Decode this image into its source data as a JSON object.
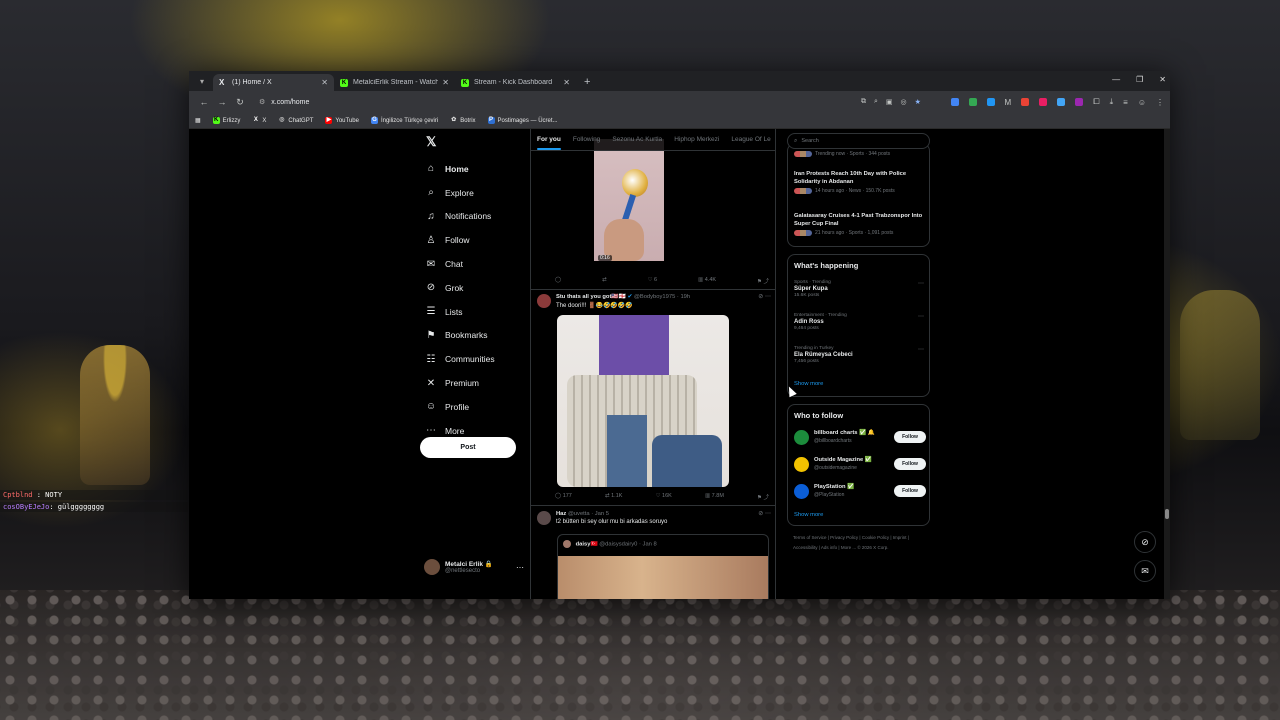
{
  "overlay_chat": [
    {
      "user": "Cptblnd",
      "msg": "NOTY"
    },
    {
      "user": "cosOByEJeJo",
      "msg": ": gülgggggggg"
    }
  ],
  "browser": {
    "tabs": [
      {
        "title": "(1) Home / X",
        "active": true,
        "favicon": "x-logo-icon"
      },
      {
        "title": "MetalciErlik Stream - Watch Liv",
        "active": false,
        "favicon": "kick-icon"
      },
      {
        "title": "Stream - Kick Dashboard",
        "active": false,
        "favicon": "kick-icon"
      }
    ],
    "url": "x.com/home",
    "bookmarks": [
      "Erlizzy",
      "X",
      "ChatGPT",
      "YouTube",
      "İngilizce Türkçe çeviri",
      "Botrix",
      "Postimages — Ücret..."
    ]
  },
  "nav": {
    "items": [
      {
        "label": "Home",
        "icon": "home-icon"
      },
      {
        "label": "Explore",
        "icon": "search-icon"
      },
      {
        "label": "Notifications",
        "icon": "bell-icon"
      },
      {
        "label": "Follow",
        "icon": "follow-icon"
      },
      {
        "label": "Chat",
        "icon": "chat-icon"
      },
      {
        "label": "Grok",
        "icon": "grok-icon"
      },
      {
        "label": "Lists",
        "icon": "lists-icon"
      },
      {
        "label": "Bookmarks",
        "icon": "bookmark-icon"
      },
      {
        "label": "Communities",
        "icon": "communities-icon"
      },
      {
        "label": "Premium",
        "icon": "x-logo-icon"
      },
      {
        "label": "Profile",
        "icon": "profile-icon"
      },
      {
        "label": "More",
        "icon": "more-icon"
      }
    ],
    "post_label": "Post",
    "account_name": "Metalci Erlik 🔒",
    "account_handle": "@nettlesecto"
  },
  "timeline": {
    "tabs": [
      "For you",
      "Following",
      "Sezonu Ac Kurtla",
      "Hiphop Merkezi",
      "League Of Le"
    ],
    "tweet0": {
      "duration": "0:16",
      "replies": "",
      "reposts": "",
      "likes": "6",
      "views": "4.4K"
    },
    "tweet1": {
      "name": "Stu thats all you got🇺🇸🏴󠁧󠁢󠁥󠁮󠁧󠁿",
      "handle": "@Bodyboy1975 · 19h",
      "text": "The doori!!! 🚪😂🤣🤣🤣🤣",
      "replies": "177",
      "reposts": "1.1K",
      "likes": "16K",
      "views": "7.8M"
    },
    "tweet2": {
      "name": "Haz",
      "handle": "@uvetta · Jan 5",
      "text": "t2 bütten bi sey olur mu bi arkadas soruyo",
      "quote_name": "daisy🇹🇷",
      "quote_handle": "@daisysdairy0 · Jan 8"
    }
  },
  "right": {
    "search_placeholder": "Search",
    "news": [
      {
        "title": "",
        "meta": "Trending now · Sports · 344 posts"
      },
      {
        "title": "Iran Protests Reach 10th Day with Police Solidarity in Abdanan",
        "meta": "14 hours ago · News · 150.7K posts"
      },
      {
        "title": "Galatasaray Cruises 4-1 Past Trabzonspor Into Super Cup Final",
        "meta": "21 hours ago · Sports · 1,091 posts"
      }
    ],
    "whats_happening": "What's happening",
    "trends": [
      {
        "context": "Sports · Trending",
        "name": "Süper Kupa",
        "posts": "15.6K posts"
      },
      {
        "context": "Entertainment · Trending",
        "name": "Adin Ross",
        "posts": "9,464 posts"
      },
      {
        "context": "Trending in Turkey",
        "name": "Ela Rümeysa Cebeci",
        "posts": "7,456 posts"
      }
    ],
    "show_more": "Show more",
    "who_to_follow": "Who to follow",
    "follow_suggestions": [
      {
        "name": "billboard charts ✅ 🔔",
        "handle": "@billboardcharts",
        "button": "Follow",
        "color": "#1c8c3c"
      },
      {
        "name": "Outside Magazine ✅",
        "handle": "@outsidemagazine",
        "button": "Follow",
        "color": "#f2c200"
      },
      {
        "name": "PlayStation ✅",
        "handle": "@PlayStation",
        "button": "Follow",
        "color": "#0b5ed7"
      }
    ],
    "footer": "Terms of Service | Privacy Policy | Cookie Policy | Imprint | Accessibility | Ads info | More ... © 2026 X Corp."
  }
}
